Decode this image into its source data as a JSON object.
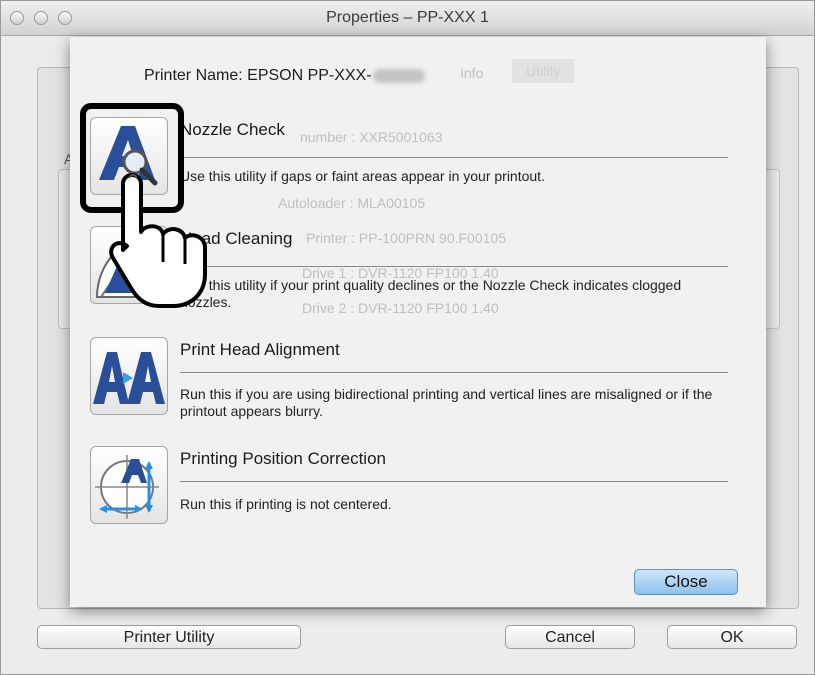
{
  "window": {
    "title": "Properties – PP-XXX 1"
  },
  "background": {
    "left_label": "A",
    "ghost_lines": [
      "Info",
      "Utility",
      "number : XXR5001063",
      "Autoloader : MLA00105",
      "Printer : PP-100PRN 90.F00105",
      "Drive 1 : DVR-1120 FP100 1.40",
      "Drive 2 : DVR-1120 FP100 1.40"
    ],
    "buttons": {
      "printer_utility": "Printer Utility",
      "cancel": "Cancel",
      "ok": "OK"
    }
  },
  "sheet": {
    "printer_name": "Printer Name: EPSON PP-XXX-",
    "items": [
      {
        "title": "Nozzle Check",
        "description": "Use this utility if gaps or faint areas appear in your printout.",
        "icon": "nozzle-check-icon"
      },
      {
        "title": "Head Cleaning",
        "description": "Use this utility if your print quality declines or the Nozzle Check indicates clogged nozzles.",
        "icon": "head-cleaning-icon"
      },
      {
        "title": "Print Head Alignment",
        "description": "Run this if you are using bidirectional printing and vertical lines are misaligned or if the printout appears blurry.",
        "icon": "print-head-alignment-icon"
      },
      {
        "title": "Printing Position Correction",
        "description": "Run this if printing is not centered.",
        "icon": "printing-position-correction-icon"
      }
    ],
    "close_label": "Close"
  },
  "colors": {
    "accent_blue": "#2a4f98",
    "close_button": "#9cc8ef",
    "highlight": "#000000"
  }
}
